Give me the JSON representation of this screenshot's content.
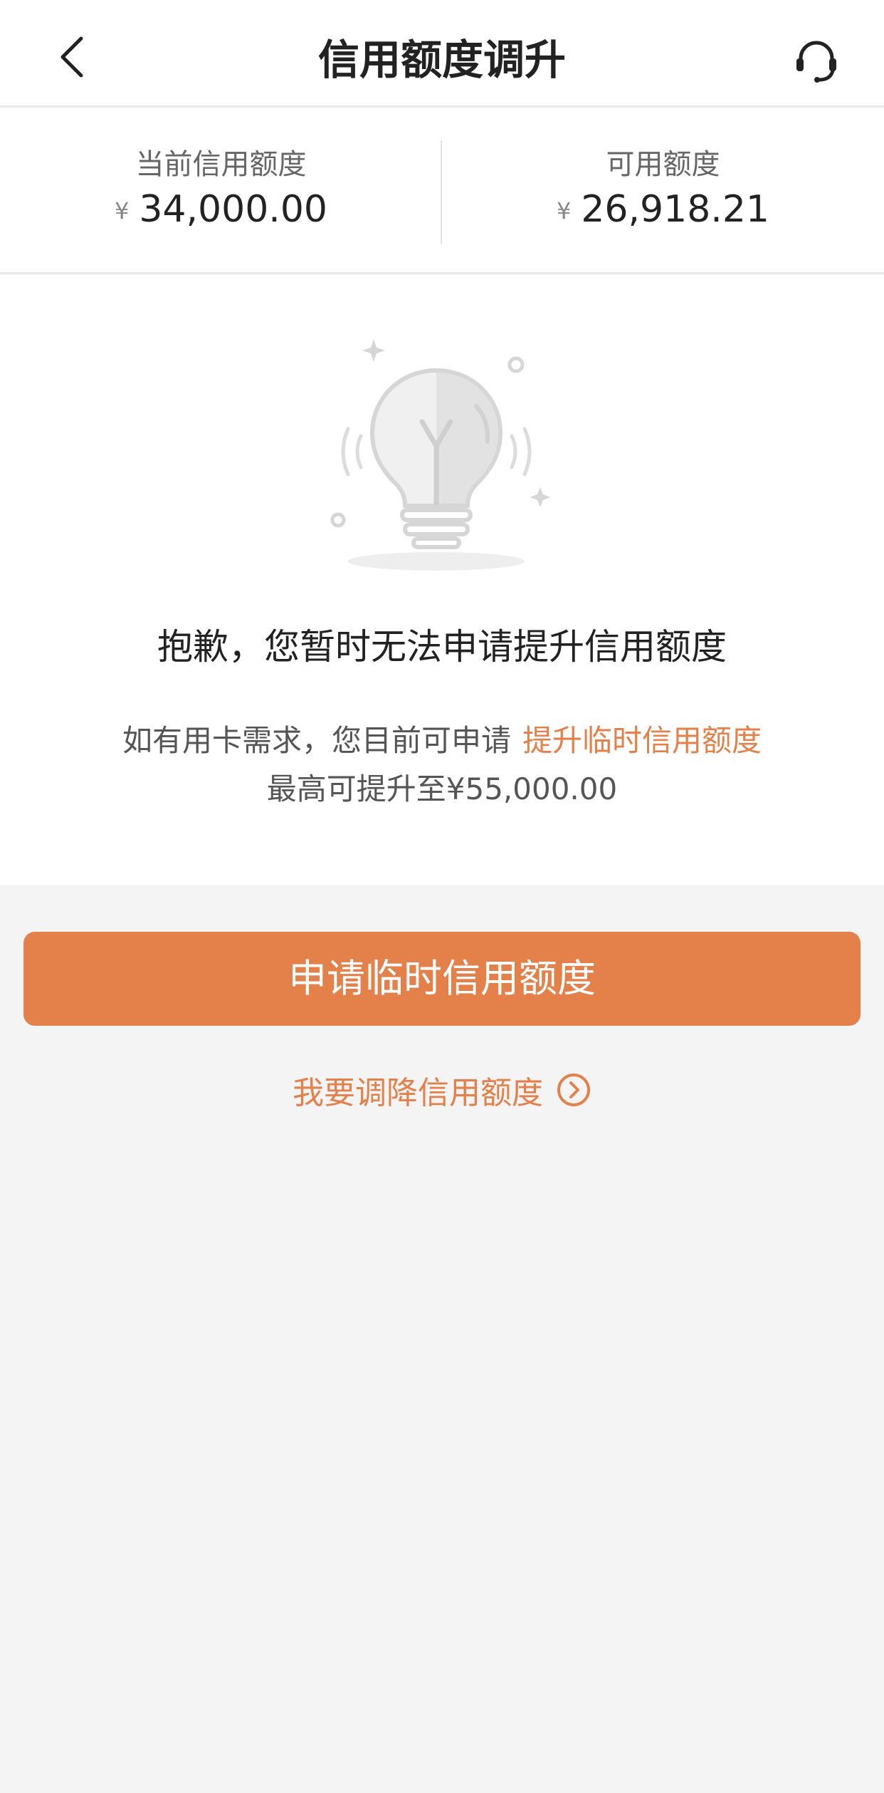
{
  "header": {
    "title": "信用额度调升",
    "back_icon": "chevron-left-icon",
    "service_icon": "headset-icon"
  },
  "summary": {
    "currency_symbol": "¥",
    "current_limit": {
      "label": "当前信用额度",
      "value": "34,000.00"
    },
    "available_limit": {
      "label": "可用额度",
      "value": "26,918.21"
    }
  },
  "notice": {
    "illustration": "lightbulb-icon",
    "title": "抱歉，您暂时无法申请提升信用额度",
    "line1_prefix": "如有用卡需求，您目前可申请",
    "line1_link": "提升临时信用额度",
    "line2": "最高可提升至¥55,000.00"
  },
  "actions": {
    "primary_label": "申请临时信用额度",
    "secondary_label": "我要调降信用额度",
    "secondary_icon": "circle-chevron-right-icon"
  },
  "colors": {
    "accent": "#e4804a",
    "background": "#f4f4f4",
    "card": "#ffffff"
  }
}
